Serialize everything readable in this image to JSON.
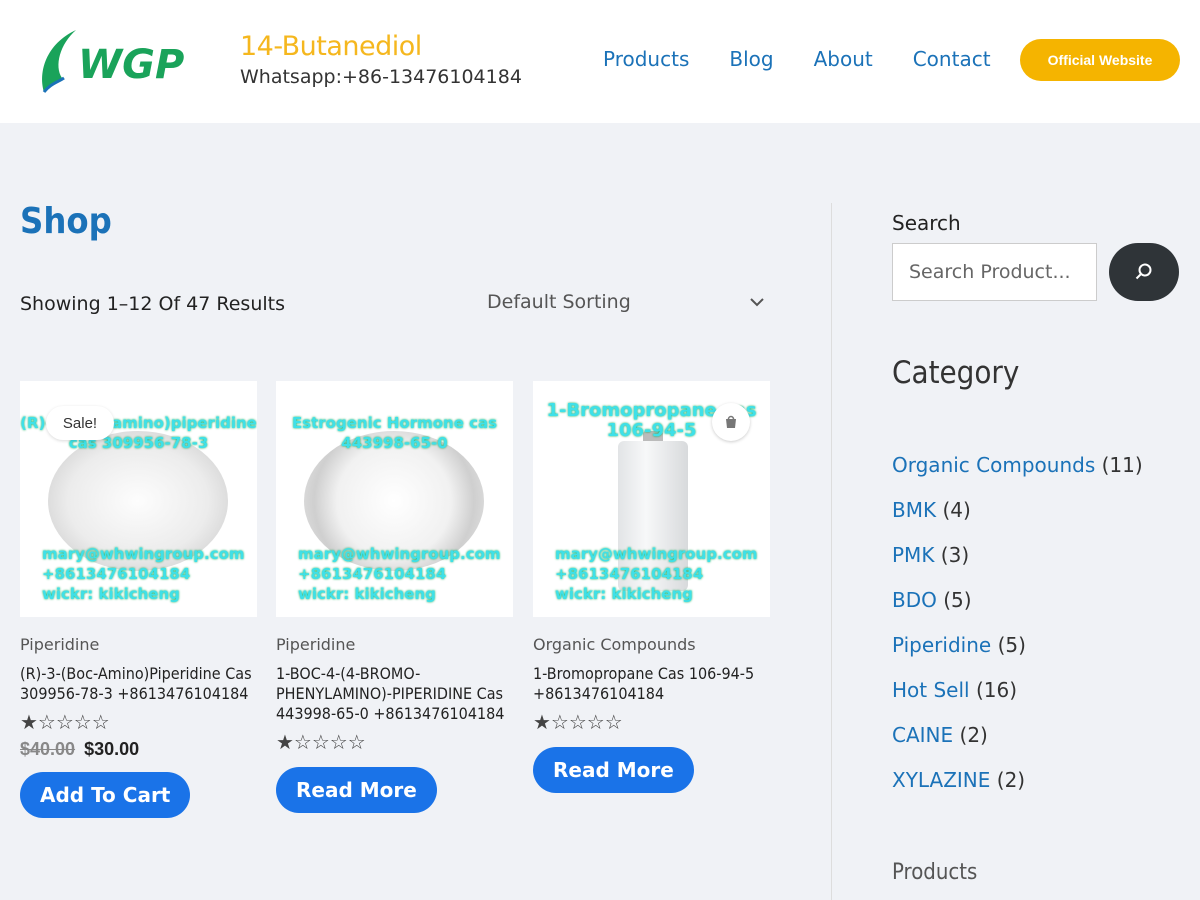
{
  "header": {
    "site_title": "14-Butanediol",
    "tagline": "Whatsapp:+86-13476104184",
    "logo_text": "WGP",
    "nav": [
      {
        "label": "Products"
      },
      {
        "label": "Blog"
      },
      {
        "label": "About"
      },
      {
        "label": "Contact"
      }
    ],
    "official_button": "Official Website",
    "colors": {
      "title": "#f5b71e",
      "nav": "#1b72b8",
      "official_btn": "#f5b400"
    }
  },
  "main": {
    "title": "Shop",
    "results": "Showing 1–12 Of 47 Results",
    "sorting": "Default Sorting"
  },
  "products": [
    {
      "badge": "Sale!",
      "watermark_top": "(R)-3-(Boc-amino)piperidine cas 309956-78-3",
      "watermark_bottom": "mary@whwingroup.com\n+8613476104184\nwickr: kikicheng",
      "category": "Piperidine",
      "name": "(R)-3-(Boc-Amino)Piperidine Cas 309956-78-3 +8613476104184",
      "rating_stars": "★☆☆☆☆",
      "price_old": "$40.00",
      "price_new": "$30.00",
      "button": "Add To Cart"
    },
    {
      "watermark_top": "Estrogenic Hormone cas 443998-65-0",
      "watermark_bottom": "mary@whwingroup.com\n+8613476104184\nwickr: kikicheng",
      "category": "Piperidine",
      "name": "1-BOC-4-(4-BROMO-PHENYLAMINO)-PIPERIDINE Cas 443998-65-0 +8613476104184",
      "rating_stars": "★☆☆☆☆",
      "button": "Read More"
    },
    {
      "watermark_top": "1-Bromopropane cas 106-94-5",
      "watermark_bottom": "mary@whwingroup.com\n+8613476104184\nwickr: kikicheng",
      "category": "Organic Compounds",
      "name": "1-Bromopropane Cas 106-94-5 +8613476104184",
      "rating_stars": "★☆☆☆☆",
      "button": "Read More"
    }
  ],
  "sidebar": {
    "search_label": "Search",
    "search_placeholder": "Search Product...",
    "category_title": "Category",
    "categories": [
      {
        "name": "Organic Compounds",
        "count": "(11)"
      },
      {
        "name": "BMK",
        "count": "(4)"
      },
      {
        "name": "PMK",
        "count": "(3)"
      },
      {
        "name": "BDO",
        "count": "(5)"
      },
      {
        "name": "Piperidine",
        "count": "(5)"
      },
      {
        "name": "Hot Sell",
        "count": "(16)"
      },
      {
        "name": "CAINE",
        "count": "(2)"
      },
      {
        "name": "XYLAZINE",
        "count": "(2)"
      }
    ],
    "products_title": "Products"
  }
}
